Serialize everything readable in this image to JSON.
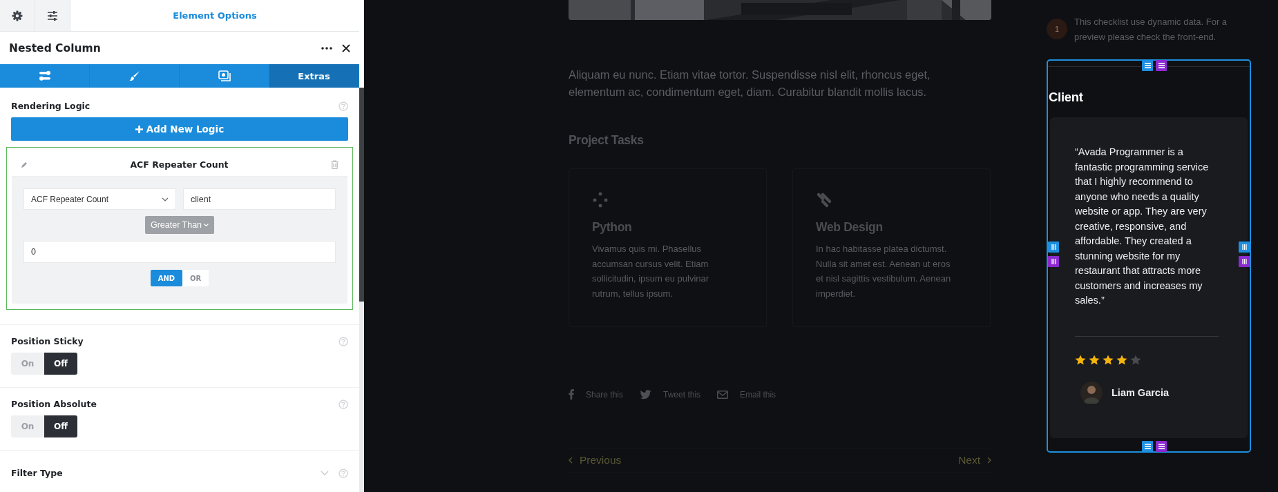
{
  "panel": {
    "top_tabs": [
      {
        "kind": "gear",
        "selected": false
      },
      {
        "kind": "sliders",
        "selected": false
      },
      {
        "kind": "text",
        "label": "Element Options",
        "selected": true
      }
    ],
    "title": "Nested Column",
    "option_tabs": [
      {
        "kind": "sliders",
        "selected": false
      },
      {
        "kind": "brush",
        "selected": false
      },
      {
        "kind": "media",
        "selected": false
      },
      {
        "kind": "text",
        "label": "Extras",
        "selected": true
      }
    ],
    "rendering_logic": {
      "label": "Rendering Logic",
      "add_button": "Add New Logic",
      "rule": {
        "title": "ACF Repeater Count",
        "field": "ACF Repeater Count",
        "name_value": "client",
        "operator": "Greater Than",
        "value": "0",
        "connectors": [
          {
            "label": "AND",
            "selected": true
          },
          {
            "label": "OR",
            "selected": false
          }
        ]
      }
    },
    "toggles": [
      {
        "label": "Position Sticky",
        "options": [
          {
            "label": "On",
            "selected": false
          },
          {
            "label": "Off",
            "selected": true
          }
        ]
      },
      {
        "label": "Position Absolute",
        "options": [
          {
            "label": "On",
            "selected": false
          },
          {
            "label": "Off",
            "selected": true
          }
        ]
      }
    ],
    "filter_type": {
      "label": "Filter Type"
    }
  },
  "page": {
    "paragraph": "Aliquam eu nunc. Etiam vitae tortor. Suspendisse nisl elit, rhoncus eget, elementum ac, condimentum eget, diam. Curabitur blandit mollis lacus.",
    "section_title": "Project Tasks",
    "tasks": [
      {
        "kind": "dots",
        "title": "Python",
        "text": "Vivamus quis mi. Phasellus accumsan cursus velit. Etiam sollicitudin, ipsum eu pulvinar rutrum, tellus ipsum."
      },
      {
        "kind": "stripes",
        "title": "Web Design",
        "text": "In hac habitasse platea dictumst. Nulla sit amet est. Aenean ut eros et nisl sagittis vestibulum. Aenean imperdiet."
      }
    ],
    "share": [
      {
        "kind": "facebook",
        "label": "Share this"
      },
      {
        "kind": "twitter",
        "label": "Tweet this"
      },
      {
        "kind": "email",
        "label": "Email this"
      }
    ],
    "nav": {
      "previous": "Previous",
      "next": "Next"
    }
  },
  "sidebar": {
    "checklist": {
      "number": "1",
      "text": "This checklist use dynamic data. For a preview please check the front-end."
    },
    "client": {
      "title": "Client",
      "quote": "“Avada Programmer is a fantastic programming service that I highly recommend to anyone who needs a quality website or app. They are very creative, responsive, and affordable. They created a stunning website for my restaurant that attracts more customers and increases my sales.”",
      "stars": 4,
      "name": "Liam Garcia"
    }
  }
}
